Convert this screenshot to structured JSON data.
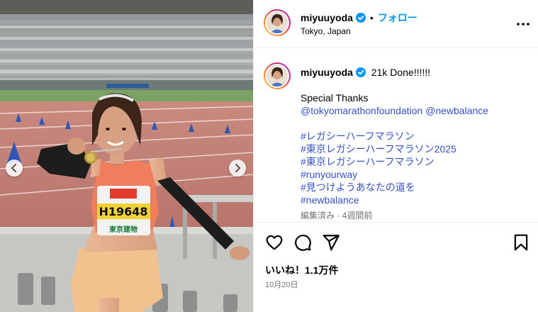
{
  "header": {
    "username": "miyuuyoda",
    "dot": "•",
    "follow_label": "フォロー",
    "location": "Tokyo, Japan"
  },
  "caption": {
    "username": "miyuuyoda",
    "first_line": "21k Done!!!!!!",
    "thanks": "Special Thanks",
    "mention_1": "@tokyomarathonfoundation",
    "mention_2": "@newbalance",
    "hashtags": [
      "#レガシーハーフマラソン",
      "#東京レガシーハーフマラソン2025",
      "#東京レガシーハーフマラソン",
      "#runyourway",
      "#見つけようあなたの道を",
      "#newbalance"
    ],
    "meta": "編集済み · 4週間前"
  },
  "photo": {
    "bib_number": "H19648",
    "bib_sponsor": "東京建物"
  },
  "actions": {
    "likes": "いいね！1.1万件",
    "date": "10月20日"
  },
  "colors": {
    "accent": "#0095f6",
    "hashtag": "#3551c4",
    "verified": "#0095f6"
  }
}
